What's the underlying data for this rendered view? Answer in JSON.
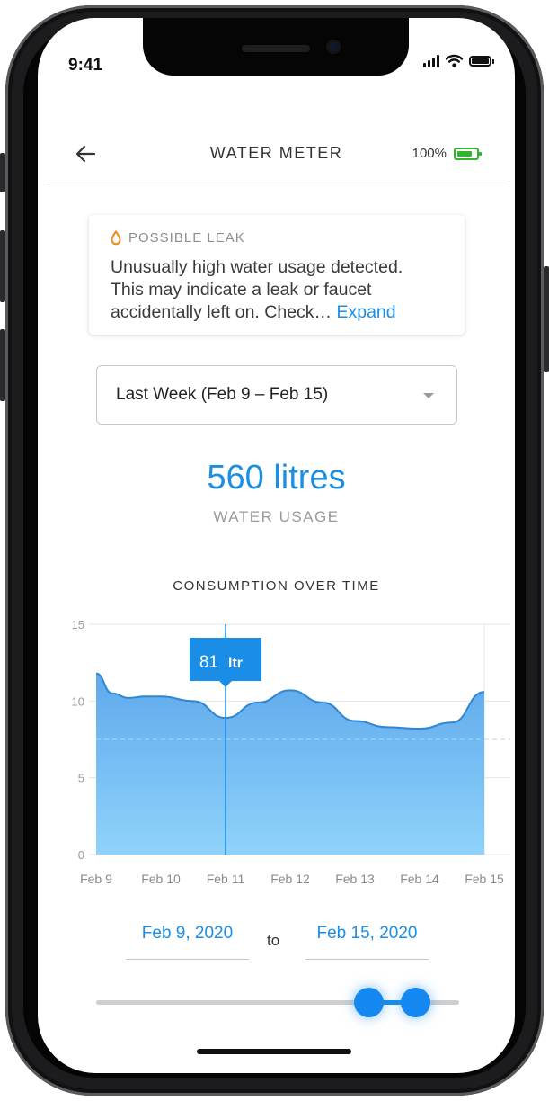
{
  "status_bar": {
    "time": "9:41"
  },
  "header": {
    "title": "WATER METER",
    "battery_percent": "100%"
  },
  "alert": {
    "title": "POSSIBLE LEAK",
    "line1": "Unusually high water usage detected.",
    "line2": "This may indicate a leak or faucet",
    "line3": "accidentally left on. Check…",
    "expand_label": "Expand"
  },
  "range_select": {
    "selected": "Last Week (Feb 9 – Feb 15)"
  },
  "usage": {
    "value": "560 litres",
    "label": "WATER USAGE"
  },
  "colors": {
    "accent": "#1a8de6",
    "area_top": "#5ea9eb",
    "area_bottom": "#8fd3fb",
    "battery": "#2fb52f",
    "leak_icon": "#f08a1a"
  },
  "chart_data": {
    "type": "area",
    "title": "CONSUMPTION OVER TIME",
    "categories": [
      "Feb 9",
      "Feb 10",
      "Feb 11",
      "Feb 12",
      "Feb 13",
      "Feb 14",
      "Feb 15"
    ],
    "y_ticks": [
      "15",
      "10",
      "5",
      "0"
    ],
    "ylim": [
      0,
      15
    ],
    "series": [
      {
        "x": [
          0,
          0.25,
          0.5,
          0.75,
          1,
          1.5,
          2,
          2.5,
          3,
          3.5,
          4,
          4.5,
          5,
          5.5,
          6
        ],
        "values": [
          11.8,
          10.5,
          10.2,
          10.3,
          10.3,
          10.0,
          8.9,
          9.9,
          10.7,
          9.9,
          8.7,
          8.3,
          8.2,
          8.6,
          10.6
        ]
      }
    ],
    "reference_line": 7.5,
    "tooltip": {
      "x_index": 2,
      "value": "81",
      "unit": "ltr"
    },
    "grid": true
  },
  "date_range": {
    "start": "Feb 9, 2020",
    "to_label": "to",
    "end": "Feb 15, 2020"
  },
  "slider": {
    "min": 0,
    "max": 1,
    "start": 0.75,
    "end": 0.88
  }
}
